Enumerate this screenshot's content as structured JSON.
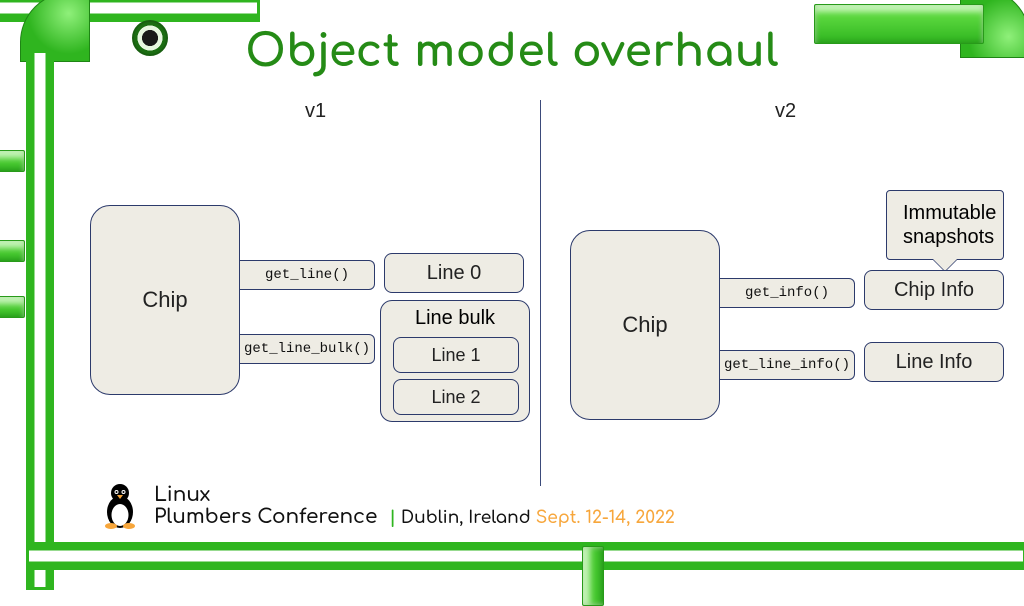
{
  "title": "Object model overhaul",
  "cols": {
    "v1": "v1",
    "v2": "v2"
  },
  "v1": {
    "chip": "Chip",
    "method_line": "get_line()",
    "method_bulk": "get_line_bulk()",
    "line0": "Line 0",
    "bulk_title": "Line bulk",
    "line1": "Line 1",
    "line2": "Line 2"
  },
  "v2": {
    "chip": "Chip",
    "note_top": "Immutable",
    "note_bot": "snapshots",
    "method_info": "get_info()",
    "method_lineinfo": "get_line_info()",
    "chip_info": "Chip Info",
    "line_info": "Line Info"
  },
  "footer": {
    "line1": "Linux",
    "line2": "Plumbers Conference",
    "location": "Dublin, Ireland",
    "dates": "Sept. 12-14, 2022"
  },
  "colors": {
    "title": "#258b16",
    "box_stroke": "#2c3a6b",
    "box_fill": "#eeece4",
    "pipe": "#2fb51f",
    "date": "#f7a63b"
  }
}
